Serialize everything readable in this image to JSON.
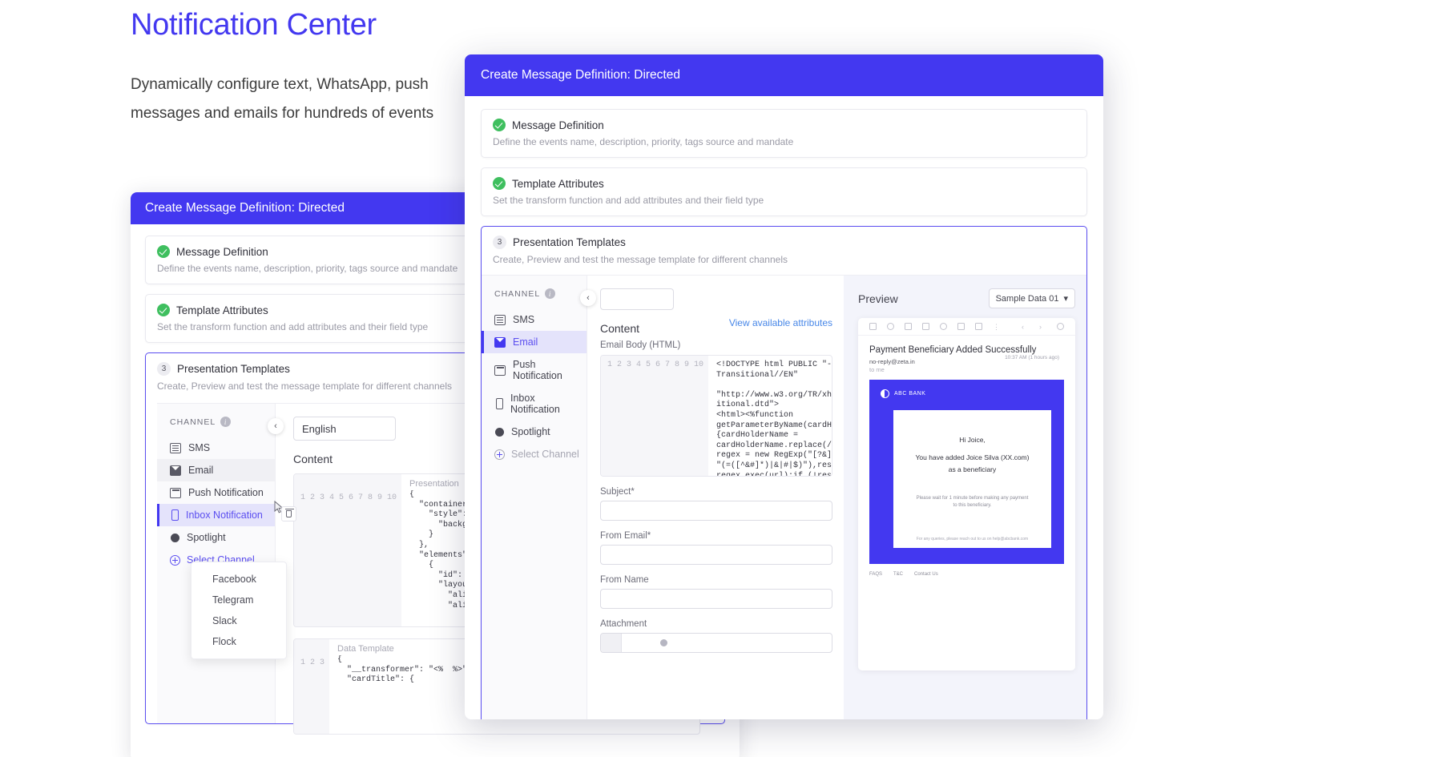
{
  "hero": {
    "title": "Notification Center",
    "subtitle": "Dynamically configure text, WhatsApp, push messages and emails for hundreds of events",
    "accent_color": "#4338f0"
  },
  "back_modal": {
    "header_title": "Create Message Definition: Directed",
    "steps": [
      {
        "badge": "check",
        "title": "Message Definition",
        "desc": "Define the events name, description, priority, tags source and mandate"
      },
      {
        "badge": "check",
        "title": "Template Attributes",
        "desc": "Set the transform function and add attributes and their field type"
      },
      {
        "badge": "3",
        "title": "Presentation Templates",
        "desc": "Create, Preview and test the message template for different channels"
      }
    ],
    "channel_header": "CHANNEL",
    "channels": [
      {
        "label": "SMS",
        "icon": "sms-icon",
        "state": "normal"
      },
      {
        "label": "Email",
        "icon": "email-icon",
        "state": "hovered"
      },
      {
        "label": "Push Notification",
        "icon": "push-icon",
        "state": "normal"
      },
      {
        "label": "Inbox Notification",
        "icon": "inbox-icon",
        "state": "selected"
      },
      {
        "label": "Spotlight",
        "icon": "spotlight-icon",
        "state": "normal"
      }
    ],
    "select_channel_label": "Select Channel",
    "dropdown_options": [
      "Facebook",
      "Telegram",
      "Slack",
      "Flock"
    ],
    "language_value": "English",
    "content_label": "Content",
    "view_attributes_label": "View available attributes",
    "presentation_placeholder": "Presentation",
    "presentation_code": "{\n  \"container\": {\n    \"style\": {\n      \"backgroundColor\": \"#ffffff\"\n    }\n  },\n  \"elements\": [\n    {\n      \"id\": \"cardTitle\",\n      \"layout\": {\n        \"alignParentLeft\": true,\n        \"alignParentTop\": true,",
    "presentation_lines": [
      "1",
      "2",
      "3",
      "4",
      "5",
      "6",
      "7",
      "8",
      "9",
      "10"
    ],
    "data_template_label": "Data Template",
    "data_template_code": "{\n  \"__transformer\": \"<%  %>\",\n  \"cardTitle\": {",
    "data_template_lines": [
      "1",
      "2",
      "3"
    ]
  },
  "front_modal": {
    "header_title": "Create Message Definition: Directed",
    "steps": [
      {
        "badge": "check",
        "title": "Message Definition",
        "desc": "Define the events name, description, priority, tags source and mandate"
      },
      {
        "badge": "check",
        "title": "Template Attributes",
        "desc": "Set the transform function and add attributes and their field type"
      },
      {
        "badge": "3",
        "title": "Presentation Templates",
        "desc": "Create, Preview and test the message template for different channels"
      }
    ],
    "channel_header": "CHANNEL",
    "channels": [
      {
        "label": "SMS",
        "icon": "sms-icon",
        "state": "normal"
      },
      {
        "label": "Email",
        "icon": "email-icon",
        "state": "selected"
      },
      {
        "label": "Push Notification",
        "icon": "push-icon",
        "state": "normal"
      },
      {
        "label": "Inbox Notification",
        "icon": "inbox-icon",
        "state": "normal"
      },
      {
        "label": "Spotlight",
        "icon": "spotlight-icon",
        "state": "normal"
      }
    ],
    "select_channel_label": "Select Channel",
    "language_value": "",
    "content_label": "Content",
    "view_attributes_label": "View available attributes",
    "email_body_label": "Email Body (HTML)",
    "email_body_code": "<!DOCTYPE html PUBLIC \"-//W3C//DTD XHTML 1.0\nTransitional//EN\"\n\n\"http://www.w3.org/TR/xhtml1/DTD/xhtml1-trans\nitional.dtd\">\n<html><%function\ngetParameterByName(cardHolderName, url)\n{cardHolderName =\ncardHolderName.replace(/[\\[\\]]/g, \"\\\\$&\");var\nregex = new RegExp(\"[?&]\" + cardHolderName +\n\"(=([^&#]*)|&|#|$)\"),results =\nregex.exec(url);if (!results) return null;if\n(!results[2]) return '';return",
    "email_body_lines": [
      "1",
      "2",
      "3",
      "4",
      "5",
      "6",
      "7",
      "8",
      "9",
      "10"
    ],
    "fields": [
      {
        "label": "Subject*",
        "value": ""
      },
      {
        "label": "From Email*",
        "value": ""
      },
      {
        "label": "From Name",
        "value": ""
      },
      {
        "label": "Attachment",
        "value": ""
      }
    ],
    "preview": {
      "title": "Preview",
      "sample_data_label": "Sample Data 01",
      "mail_subject": "Payment Beneficiary Added Successfully",
      "mail_from": "no-reply@zeta.in",
      "mail_to": "to me",
      "mail_meta": "10:37 AM (1 hours ago)",
      "bank_name": "ABC BANK",
      "greeting": "Hi Joice,",
      "body_line": "You have added Joice Silva (XX.com) as a beneficiary",
      "notice": "Please wait for 1 minute before making any payment to this beneficiary.",
      "footer_note": "For any queries, please reach out to us on help@abcbank.com",
      "footer_links": [
        "FAQS",
        "T&C",
        "Contact Us"
      ]
    }
  }
}
